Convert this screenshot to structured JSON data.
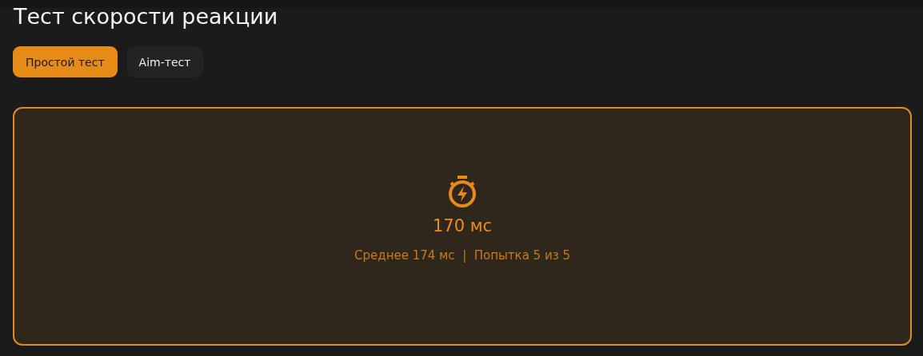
{
  "title": "Тест скорости реакции",
  "tabs": [
    {
      "label": "Простой тест",
      "selected": true
    },
    {
      "label": "Aim-тест",
      "selected": false
    }
  ],
  "panel": {
    "result": "170 мс",
    "summary": "Среднее 174 мс  |  Попытка 5 из 5"
  }
}
